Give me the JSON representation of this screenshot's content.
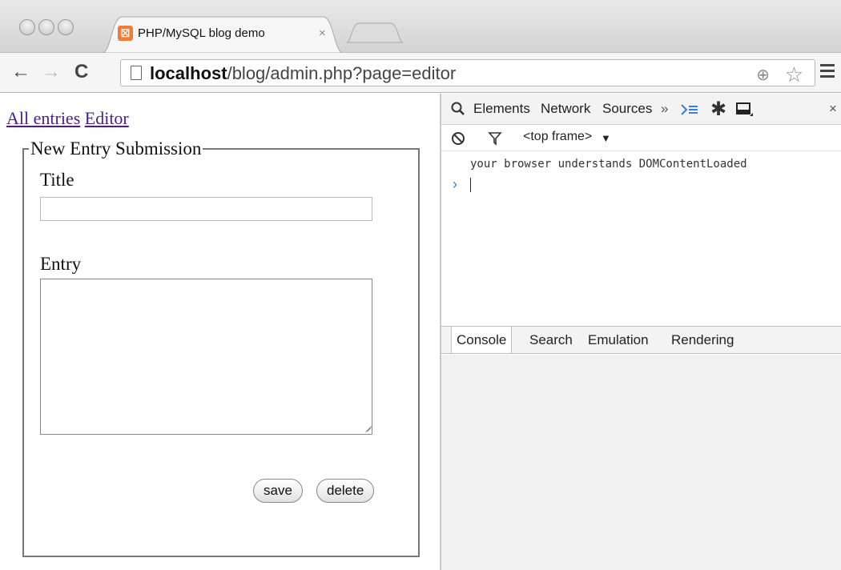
{
  "browser": {
    "tab": {
      "title": "PHP/MySQL blog demo",
      "close": "×",
      "favicon": "☒"
    },
    "nav": {
      "back": "←",
      "forward": "→",
      "reload": "C"
    },
    "url": {
      "host": "localhost",
      "path": "/blog/admin.php?page=editor"
    }
  },
  "page": {
    "nav": {
      "all_entries": "All entries",
      "editor": "Editor"
    },
    "form": {
      "legend": "New Entry Submission",
      "title_label": "Title",
      "title_value": "",
      "entry_label": "Entry",
      "entry_value": "",
      "save_label": "save",
      "delete_label": "delete"
    }
  },
  "devtools": {
    "tabs": [
      "Elements",
      "Network",
      "Sources"
    ],
    "more": "»",
    "frame": "<top frame>",
    "dropdown": "▼",
    "console_message": "your browser understands DOMContentLoaded",
    "prompt": "›",
    "drawer_tabs": [
      "Console",
      "Search",
      "Emulation",
      "Rendering"
    ],
    "close": "×"
  }
}
